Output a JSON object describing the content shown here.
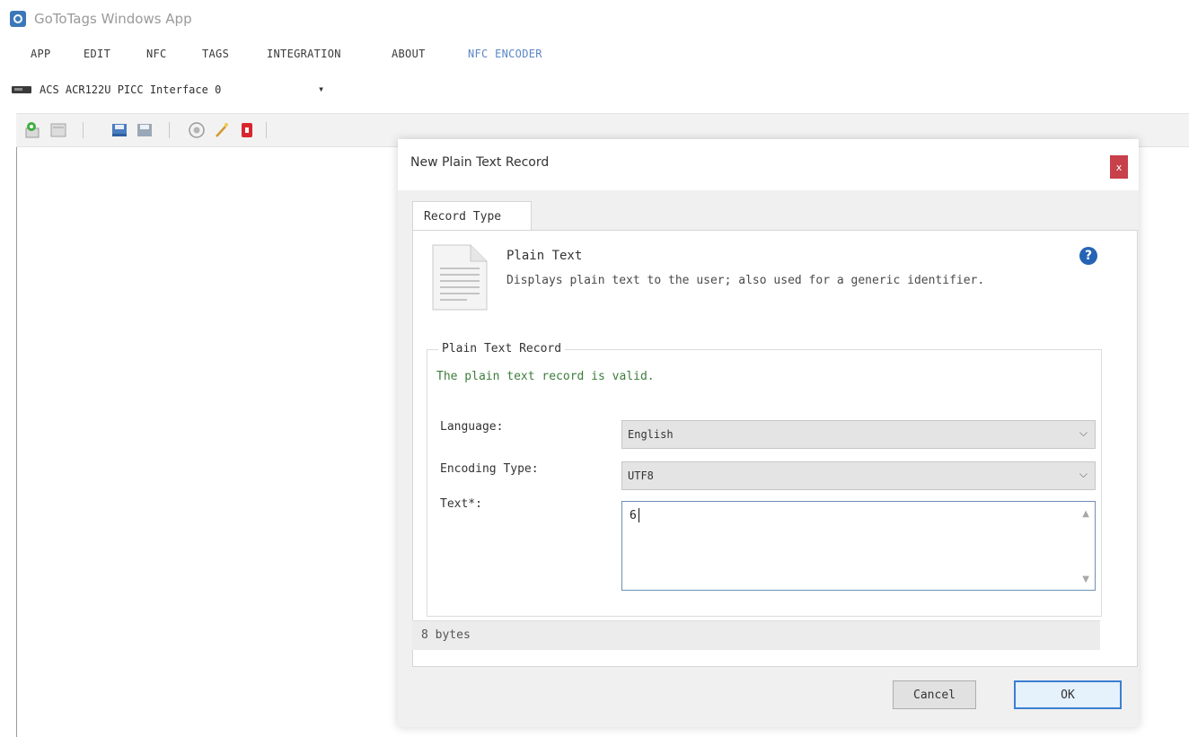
{
  "window": {
    "title": "GoToTags Windows App",
    "icon": "app-logo-icon"
  },
  "menu": [
    "APP",
    "EDIT",
    "NFC",
    "TAGS",
    "INTEGRATION",
    "ABOUT",
    "NFC ENCODER"
  ],
  "device": {
    "icon": "card-reader-icon",
    "selected": "ACS ACR122U PICC Interface 0",
    "arrow": "▾"
  },
  "toolbar": {
    "icons": [
      "new-location-icon",
      "list-icon",
      "save-as-icon",
      "save-icon",
      "nfc-target-icon",
      "wand-icon",
      "nfc-tag-icon"
    ]
  },
  "dialog": {
    "title": "New Plain Text Record",
    "close_label": "x",
    "tab": "Record Type",
    "record_type": {
      "name": "Plain Text",
      "description": "Displays plain text to the user; also used for a generic identifier.",
      "icon": "document-icon",
      "help_icon": "help-icon",
      "help_glyph": "?"
    },
    "group": {
      "legend": "Plain Text Record",
      "status": "The plain text record is valid.",
      "language_label": "Language:",
      "language_value": "English",
      "encoding_label": "Encoding Type:",
      "encoding_value": "UTF8",
      "text_label": "Text*:",
      "text_value": "6"
    },
    "bytes": "8 bytes",
    "cancel": "Cancel",
    "ok": "OK"
  },
  "colors": {
    "accent": "#5b86c6",
    "close_red": "#c7404a",
    "valid_green": "#3c7d3c",
    "help_blue": "#2563b5"
  }
}
